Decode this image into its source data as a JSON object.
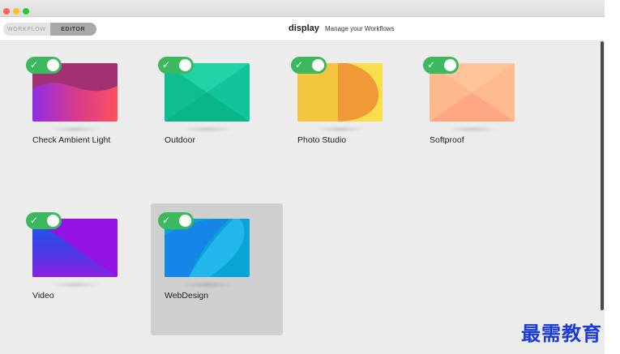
{
  "window": {
    "controls": [
      "close",
      "minimize",
      "maximize"
    ]
  },
  "toolbar": {
    "segments": [
      {
        "label": "WORKFLOW",
        "active": false
      },
      {
        "label": "EDITOR",
        "active": true
      }
    ],
    "app_title": "display",
    "app_subtitle": "Manage your Workflows"
  },
  "workflows": [
    {
      "name": "Check Ambient Light",
      "enabled": true,
      "selected": false,
      "icon": "check-icon"
    },
    {
      "name": "Outdoor",
      "enabled": true,
      "selected": false,
      "icon": "check-icon"
    },
    {
      "name": "Photo Studio",
      "enabled": true,
      "selected": false,
      "icon": "check-icon"
    },
    {
      "name": "Softproof",
      "enabled": true,
      "selected": false,
      "icon": "check-icon"
    },
    {
      "name": "Video",
      "enabled": true,
      "selected": false,
      "icon": "check-icon"
    },
    {
      "name": "WebDesign",
      "enabled": true,
      "selected": true,
      "icon": "check-icon"
    }
  ],
  "colors": {
    "toggle_on": "#3cb85f",
    "selection": "#cfcfcf",
    "watermark": "#1b3bd8"
  },
  "watermark": "最需教育"
}
